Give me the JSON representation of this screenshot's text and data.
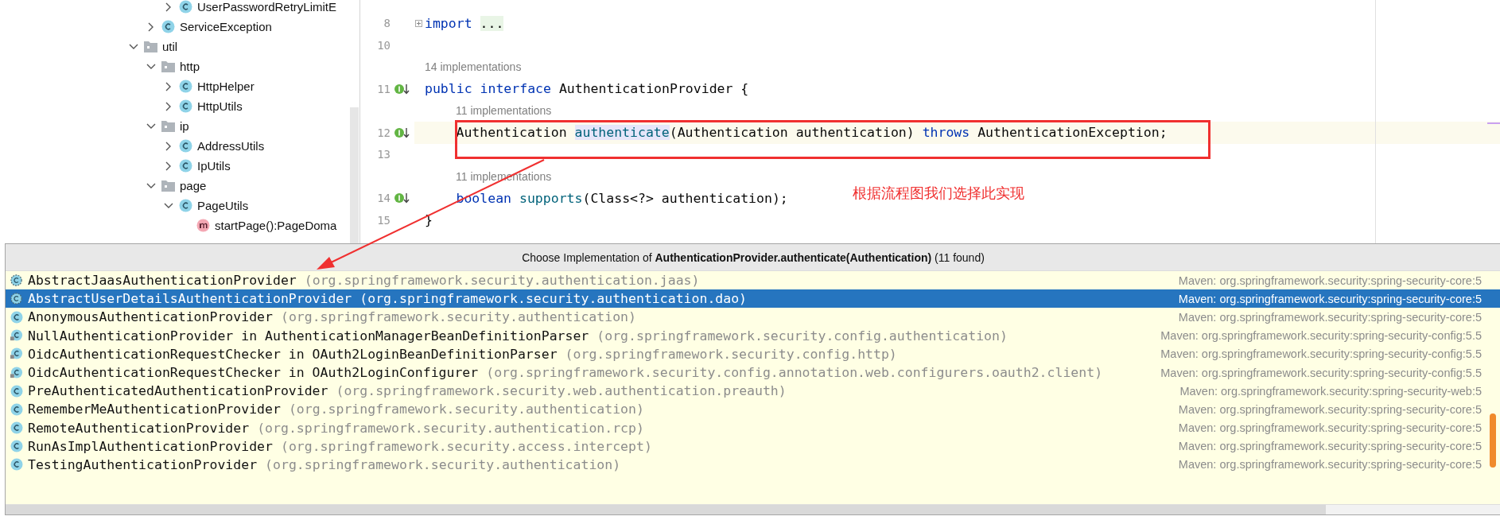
{
  "project_tree": [
    {
      "children": [
        {
          "children": [
            {
              "label": "UserPasswordRetryLimitE",
              "kind": "class",
              "expanded": false
            }
          ]
        },
        {
          "label": "ServiceException",
          "kind": "class",
          "expanded": false
        }
      ]
    },
    {
      "label": "util",
      "kind": "folder",
      "expanded": true,
      "children": [
        {
          "label": "http",
          "kind": "folder",
          "expanded": true,
          "children": [
            {
              "label": "HttpHelper",
              "kind": "class",
              "expanded": false
            },
            {
              "label": "HttpUtils",
              "kind": "class",
              "expanded": false
            }
          ]
        },
        {
          "label": "ip",
          "kind": "folder",
          "expanded": true,
          "children": [
            {
              "label": "AddressUtils",
              "kind": "class",
              "expanded": false
            },
            {
              "label": "IpUtils",
              "kind": "class",
              "expanded": false
            }
          ]
        },
        {
          "label": "page",
          "kind": "folder",
          "expanded": true,
          "children": [
            {
              "label": "PageUtils",
              "kind": "class",
              "expanded": true,
              "children": [
                {
                  "label": "startPage():PageDoma",
                  "kind": "method"
                }
              ]
            }
          ]
        }
      ]
    }
  ],
  "editor": {
    "lines": [
      {
        "kind": "code",
        "number": "8",
        "current": false,
        "folded": true,
        "implemented": false,
        "indented": false,
        "tokens": [
          {
            "kind": "keyword",
            "text": "import "
          },
          {
            "kind": "fold",
            "text": "..."
          }
        ]
      },
      {
        "kind": "code",
        "number": "10",
        "current": false,
        "implemented": false
      },
      {
        "kind": "hint",
        "text": "14 implementations",
        "indented": false
      },
      {
        "kind": "code",
        "number": "11",
        "current": false,
        "implemented": true,
        "indented": false,
        "tokens": [
          {
            "kind": "keyword",
            "text": "public interface"
          },
          {
            "kind": "plain",
            "text": " AuthenticationProvider {"
          }
        ]
      },
      {
        "kind": "hint",
        "text": "11 implementations",
        "indented": true
      },
      {
        "kind": "code",
        "number": "12",
        "current": true,
        "implemented": true,
        "indented": true,
        "tokens": [
          {
            "kind": "plain",
            "text": "Authentication "
          },
          {
            "kind": "usage",
            "text": "authenticate"
          },
          {
            "kind": "plain",
            "text": "(Authentication authentication) "
          },
          {
            "kind": "keyword",
            "text": "throws"
          },
          {
            "kind": "plain",
            "text": " AuthenticationException;"
          }
        ]
      },
      {
        "kind": "code",
        "number": "13",
        "current": false,
        "implemented": false
      },
      {
        "kind": "hint",
        "text": "11 implementations",
        "indented": true
      },
      {
        "kind": "code",
        "number": "14",
        "current": false,
        "implemented": true,
        "indented": true,
        "tokens": [
          {
            "kind": "keyword",
            "text": "boolean "
          },
          {
            "kind": "method",
            "text": "supports"
          },
          {
            "kind": "plain",
            "text": "(Class<?> authentication);"
          }
        ]
      },
      {
        "kind": "code",
        "number": "15",
        "current": false,
        "implemented": false,
        "indented": false,
        "tokens": [
          {
            "kind": "plain",
            "text": "}"
          }
        ]
      }
    ]
  },
  "annotation": {
    "text": "根据流程图我们选择此实现"
  },
  "popup": {
    "title": "Choose Implementation of **AuthenticationProvider.authenticate(Authentication)** (11 found)",
    "items": [
      {
        "name": "AbstractJaasAuthenticationProvider",
        "location": "(org.springframework.security.authentication.jaas)",
        "module": "Maven: org.springframework.security:spring-security-core:5",
        "kind": "abstract",
        "selected": false
      },
      {
        "name": "AbstractUserDetailsAuthenticationProvider",
        "location": "(org.springframework.security.authentication.dao)",
        "module": "Maven: org.springframework.security:spring-security-core:5",
        "kind": "abstract",
        "selected": true
      },
      {
        "name": "AnonymousAuthenticationProvider",
        "location": "(org.springframework.security.authentication)",
        "module": "Maven: org.springframework.security:spring-security-core:5",
        "kind": "class",
        "selected": false
      },
      {
        "name": "NullAuthenticationProvider in AuthenticationManagerBeanDefinitionParser",
        "location": "(org.springframework.security.config.authentication)",
        "module": "Maven: org.springframework.security:spring-security-config:5.5",
        "kind": "inner",
        "selected": false
      },
      {
        "name": "OidcAuthenticationRequestChecker in OAuth2LoginBeanDefinitionParser",
        "location": "(org.springframework.security.config.http)",
        "module": "Maven: org.springframework.security:spring-security-config:5.5",
        "kind": "inner",
        "selected": false
      },
      {
        "name": "OidcAuthenticationRequestChecker in OAuth2LoginConfigurer",
        "location": "(org.springframework.security.config.annotation.web.configurers.oauth2.client)",
        "module": "Maven: org.springframework.security:spring-security-config:5.5",
        "kind": "inner",
        "selected": false
      },
      {
        "name": "PreAuthenticatedAuthenticationProvider",
        "location": "(org.springframework.security.web.authentication.preauth)",
        "module": "Maven: org.springframework.security:spring-security-web:5",
        "kind": "class",
        "selected": false
      },
      {
        "name": "RememberMeAuthenticationProvider",
        "location": "(org.springframework.security.authentication)",
        "module": "Maven: org.springframework.security:spring-security-core:5",
        "kind": "class",
        "selected": false
      },
      {
        "name": "RemoteAuthenticationProvider",
        "location": "(org.springframework.security.authentication.rcp)",
        "module": "Maven: org.springframework.security:spring-security-core:5",
        "kind": "class",
        "selected": false
      },
      {
        "name": "RunAsImplAuthenticationProvider",
        "location": "(org.springframework.security.access.intercept)",
        "module": "Maven: org.springframework.security:spring-security-core:5",
        "kind": "class",
        "selected": false
      },
      {
        "name": "TestingAuthenticationProvider",
        "location": "(org.springframework.security.authentication)",
        "module": "Maven: org.springframework.security:spring-security-core:5",
        "kind": "class",
        "selected": false
      }
    ]
  }
}
